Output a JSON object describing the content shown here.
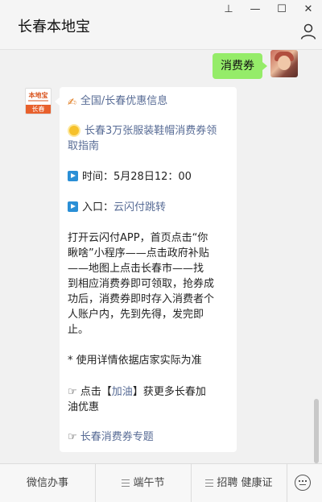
{
  "window": {
    "title": "长春本地宝",
    "controls": {
      "pin": "⊥",
      "minimize": "—",
      "maximize": "☐",
      "close": "✕"
    },
    "user_icon": "user-icon"
  },
  "chat": {
    "outgoing_message": "消费券",
    "bot_message": {
      "line1_icon": "writing-hand-icon",
      "line1": "全国/长春优惠信息",
      "line2_icon": "sun-icon",
      "line2a": "长春3万张服装鞋帽消费券领",
      "line2b": "取指南",
      "line3_icon": "play-icon",
      "line3": "时间：5月28日12：00",
      "line4_icon": "play-icon",
      "line4_label": "入口：",
      "line4_link": "云闪付跳转",
      "para1": "打开云闪付APP，首页点击“你",
      "para2": "瞅啥”小程序——点击政府补贴",
      "para3": "——地图上点击长春市——找",
      "para4": "到相应消费券即可领取，抢券成",
      "para5": "功后，消费券即时存入消费者个",
      "para6": "人账户内，先到先得，发完即",
      "para7": "止。",
      "note": "* 使用详情依据店家实际为准",
      "cta_prefix": "☞ 点击【",
      "cta_link": "加油",
      "cta_suffix": "】获更多长春加",
      "cta_line2": "油优惠",
      "topic_prefix": "☞ ",
      "topic_link": "长春消费券专题"
    }
  },
  "avatar_logo": {
    "top": "本地宝",
    "bottom": "长春"
  },
  "menu": {
    "items": [
      "微信办事",
      "端午节",
      "招聘 健康证"
    ]
  },
  "colors": {
    "outgoing_bubble": "#95ec69",
    "link": "#576b95"
  }
}
